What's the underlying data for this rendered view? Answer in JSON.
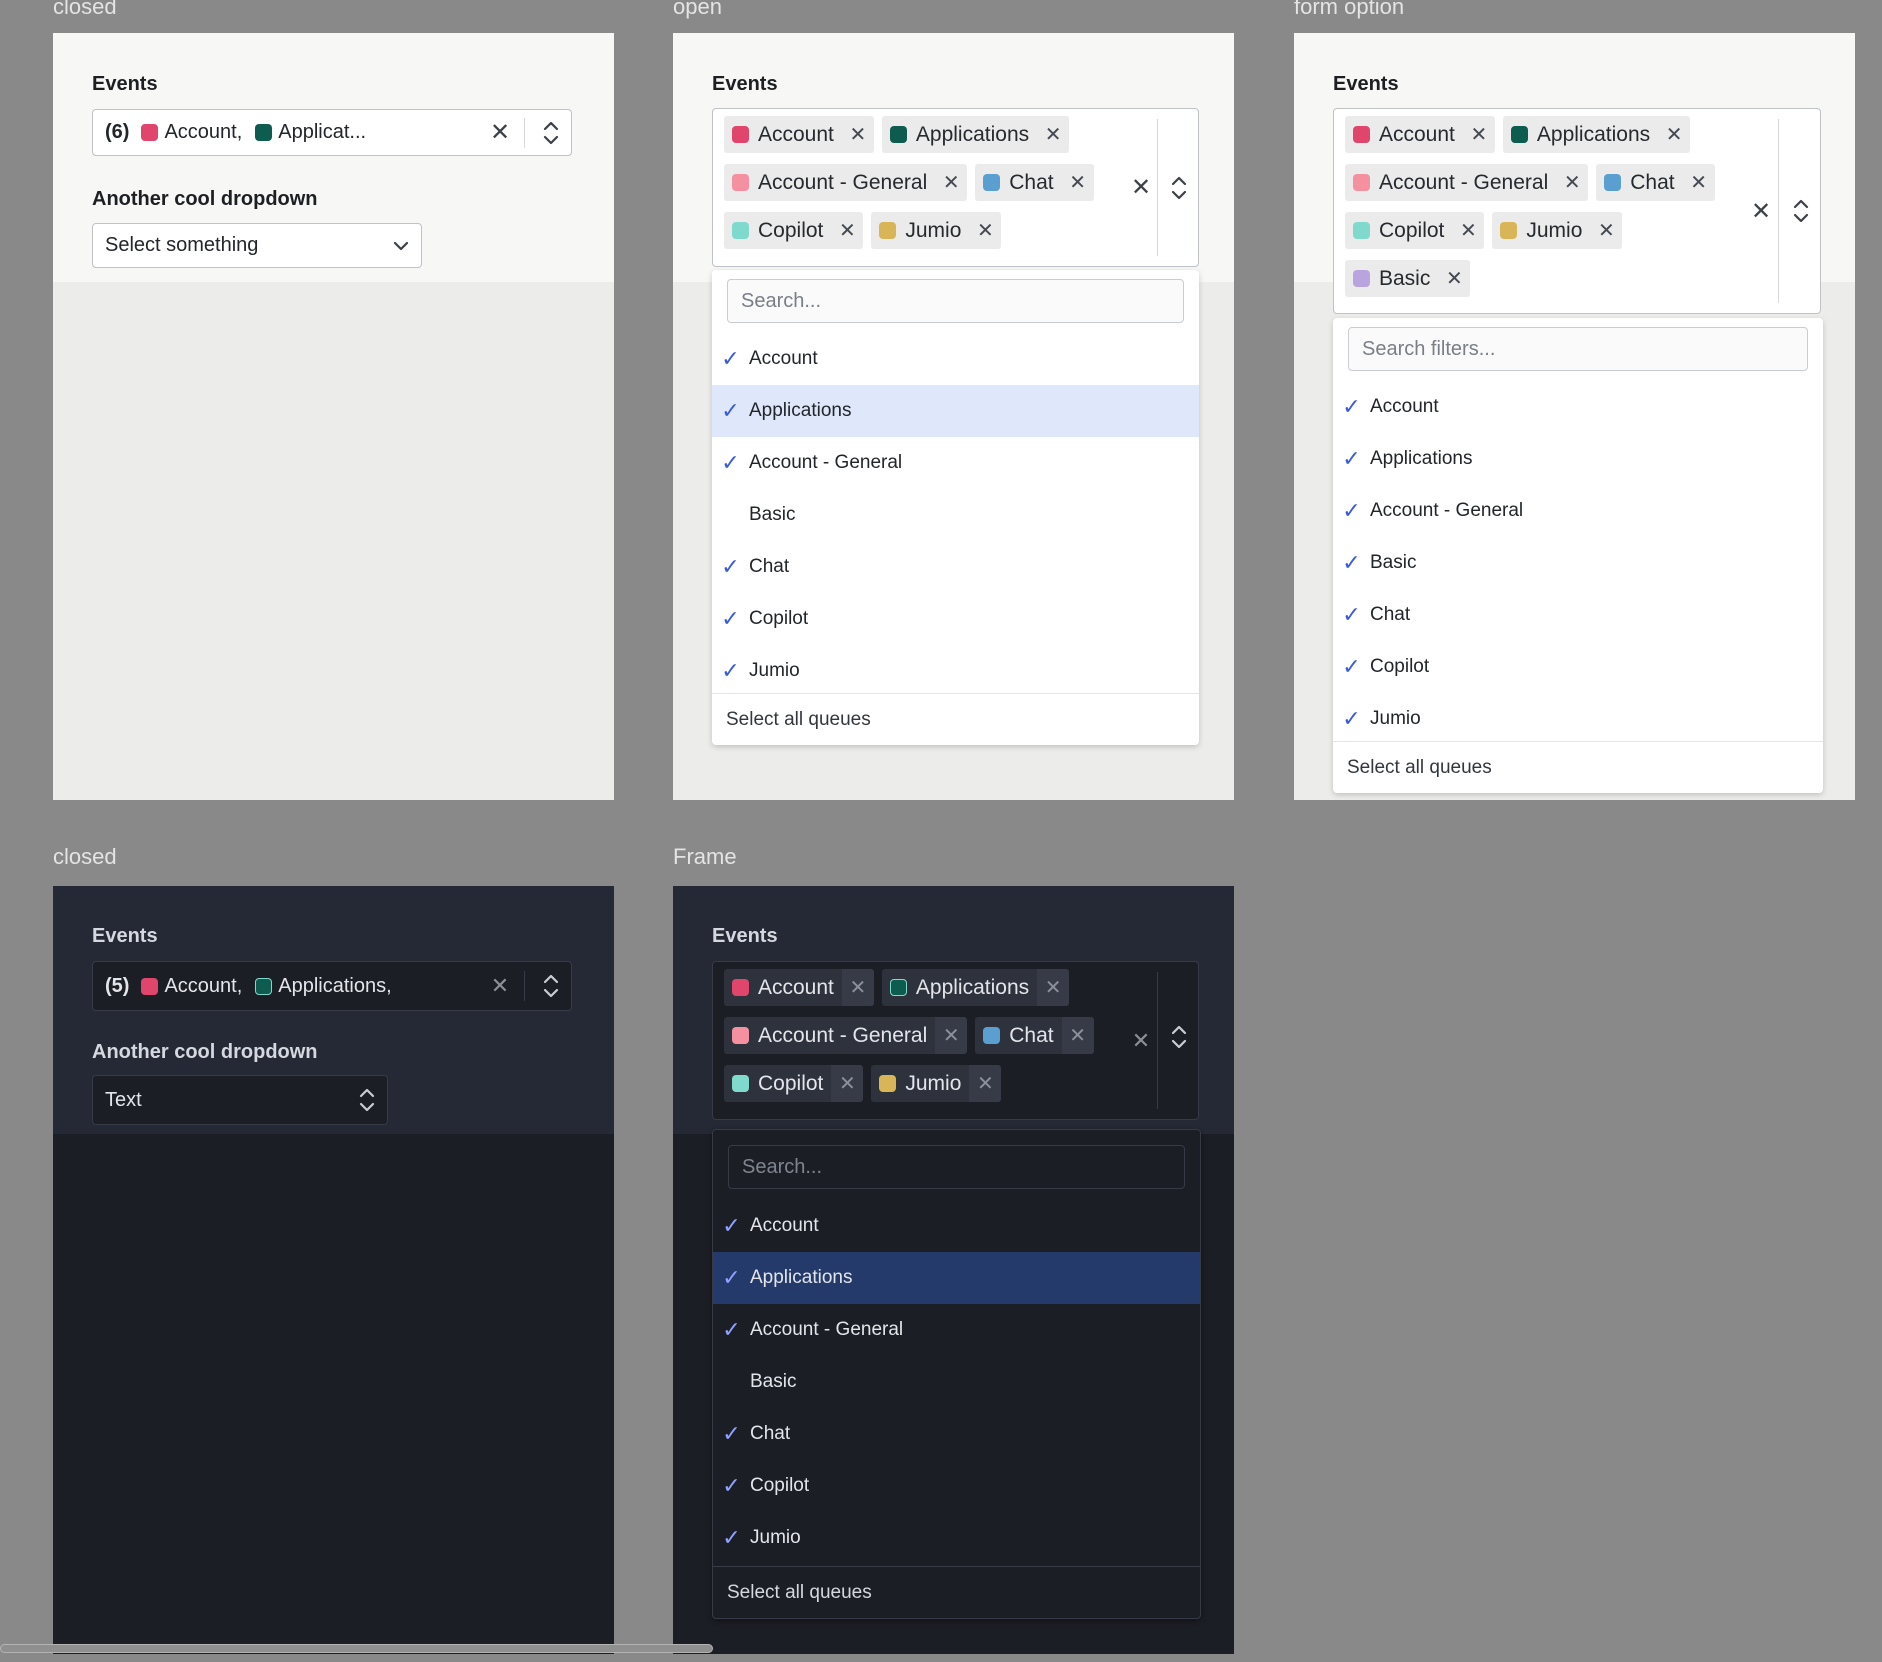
{
  "colors": {
    "account": "#e0456b",
    "applications": "#0d5c4f",
    "account_general": "#f4909f",
    "chat": "#5a9fd0",
    "copilot": "#7fd9cc",
    "jumio": "#d8b657",
    "basic": "#b9a4e0",
    "check": "#3b5bdb"
  },
  "icons": {
    "clear": "close-icon",
    "toggle": "chevron-up-down-icon",
    "select": "chevron-down-icon",
    "check": "check-icon"
  },
  "frames": {
    "light_closed": {
      "label": "closed",
      "events_label": "Events",
      "summary_count": "(6)",
      "summary_item1": "Account,",
      "summary_item2": "Applicat...",
      "another_label": "Another cool dropdown",
      "select_value": "Select something"
    },
    "light_open": {
      "label": "open",
      "events_label": "Events",
      "search_placeholder": "Search...",
      "footer": "Select all queues"
    },
    "light_form": {
      "label": "form option",
      "events_label": "Events",
      "search_placeholder": "Search filters...",
      "footer": "Select all queues"
    },
    "dark_closed": {
      "label": "closed",
      "events_label": "Events",
      "summary_count": "(5)",
      "summary_item1": "Account,",
      "summary_item2": "Applications,",
      "another_label": "Another cool dropdown",
      "select_value": "Text"
    },
    "dark_open": {
      "label": "Frame",
      "events_label": "Events",
      "search_placeholder": "Search...",
      "footer": "Select all queues"
    }
  },
  "tags": {
    "t1": "Account",
    "t2": "Applications",
    "t3": "Account - General",
    "t4": "Chat",
    "t5": "Copilot",
    "t6": "Jumio",
    "t7": "Basic"
  },
  "options": {
    "o1": "Account",
    "o2": "Applications",
    "o3": "Account - General",
    "o4": "Basic",
    "o5": "Chat",
    "o6": "Copilot",
    "o7": "Jumio"
  },
  "glyphs": {
    "check": "✓",
    "close": "✕"
  }
}
